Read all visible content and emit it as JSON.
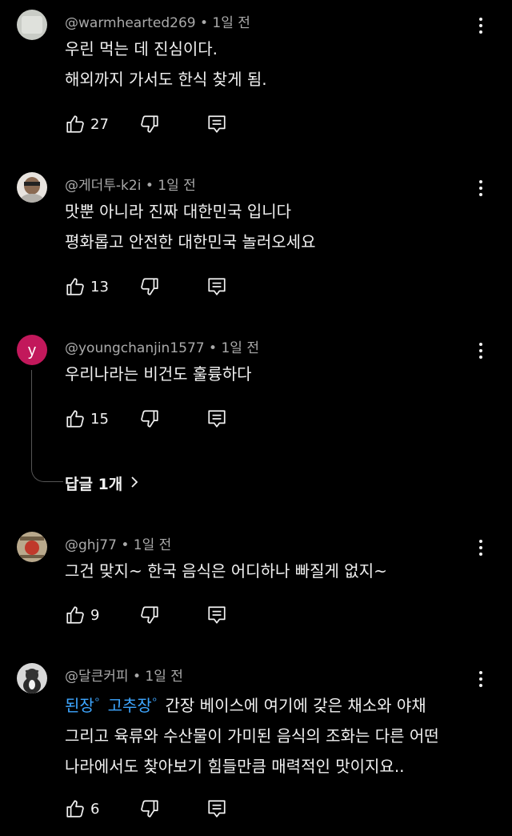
{
  "comments": [
    {
      "author": "@warmhearted269",
      "time": "1일 전",
      "lines": [
        "우린 먹는 데 진심이다.",
        "해외까지 가서도 한식 찾게 됨."
      ],
      "likes": "27"
    },
    {
      "author": "@게더투-k2i",
      "time": "1일 전",
      "lines": [
        "맛뿐 아니라 진짜 대한민국 입니다",
        "평화롭고 안전한 대한민국 놀러오세요"
      ],
      "likes": "13"
    },
    {
      "author": "@youngchanjin1577",
      "time": "1일 전",
      "avatar_letter": "y",
      "avatar_color": "#c2185b",
      "lines": [
        "우리나라는 비건도 훌륭하다"
      ],
      "likes": "15",
      "replies_label": "답글 1개"
    },
    {
      "author": "@ghj77",
      "time": "1일 전",
      "lines": [
        "그건 맞지~ 한국 음식은 어디하나 빠질게 없지~"
      ],
      "likes": "9"
    },
    {
      "author": "@달큰커피",
      "time": "1일 전",
      "hashtags": [
        "된장",
        "고추장"
      ],
      "lines": [
        "간장 베이스에 여기에 갖은 채소와 야채",
        "그리고 육류와 수산물이 가미된 음식의 조화는 다른 어떤",
        "나라에서도 찾아보기 힘들만큼 매력적인 맛이지요.."
      ],
      "likes": "6"
    }
  ],
  "colors": {
    "background": "#000000",
    "text": "#f1f1f1",
    "meta": "#aaaaaa",
    "hashtag": "#3ea6ff"
  },
  "icons": {
    "like": "thumbs-up-icon",
    "dislike": "thumbs-down-icon",
    "reply": "reply-icon",
    "more": "more-vertical-icon",
    "chevron": "chevron-right-icon"
  }
}
